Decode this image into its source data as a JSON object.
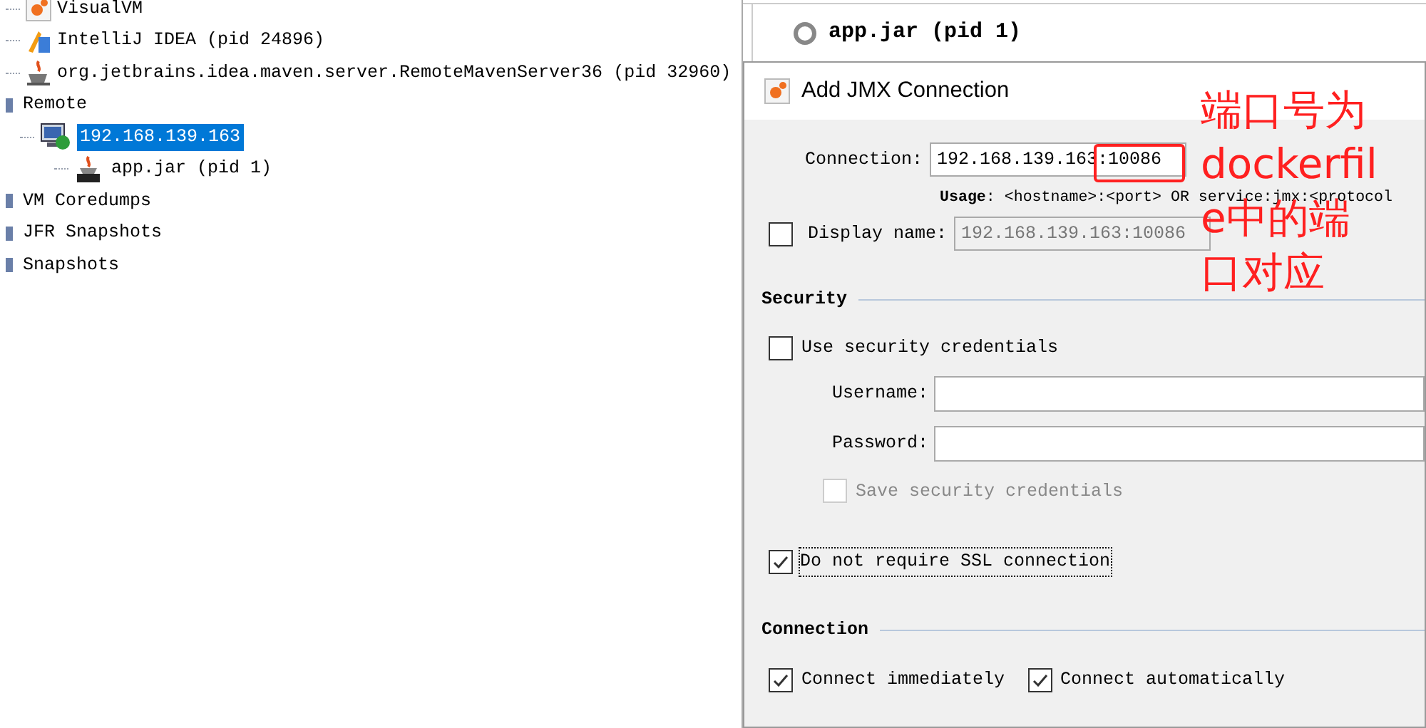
{
  "tree": {
    "continued_items": [
      {
        "label": "VisualVM",
        "kind": "visualvm"
      },
      {
        "label": "IntelliJ IDEA (pid 24896)",
        "kind": "intellij"
      },
      {
        "label": "org.jetbrains.idea.maven.server.RemoteMavenServer36 (pid 32960)",
        "kind": "java"
      }
    ],
    "roots": [
      {
        "label": "Remote",
        "kind": "folder",
        "selected": false,
        "children": [
          {
            "label": "192.168.139.163",
            "kind": "host",
            "selected": true,
            "children": [
              {
                "label": "app.jar (pid 1)",
                "kind": "jmx",
                "selected": false
              }
            ]
          }
        ]
      },
      {
        "label": "VM Coredumps",
        "kind": "folder",
        "selected": false
      },
      {
        "label": "JFR Snapshots",
        "kind": "folder",
        "selected": false
      },
      {
        "label": "Snapshots",
        "kind": "folder",
        "selected": false
      }
    ]
  },
  "process_tab": {
    "title": "app.jar (pid 1)"
  },
  "dialog": {
    "title": "Add JMX Connection",
    "connection": {
      "label": "Connection:",
      "value": "192.168.139.163:10086"
    },
    "usage": "**Usage**: <hostname>:<port> OR service:jmx:<protocol",
    "display_name": {
      "label": "Display name:",
      "checked": false,
      "value": "192.168.139.163:10086",
      "disabled": true
    },
    "security": {
      "title": "Security",
      "use_credentials": {
        "label": "Use security credentials",
        "checked": false
      },
      "username": {
        "label": "Username:"
      },
      "password": {
        "label": "Password:"
      },
      "save_credentials": {
        "label": "Save security credentials",
        "checked": false,
        "disabled": true
      }
    },
    "ssl": {
      "label": "Do not require SSL connection",
      "checked": true,
      "focused": true
    },
    "connection_section": {
      "title": "Connection",
      "options": [
        {
          "label": "Connect immediately",
          "checked": true
        },
        {
          "label": "Connect automatically",
          "checked": true
        }
      ]
    }
  },
  "annotation": {
    "lines": [
      "端口号为",
      "dockerfil",
      "e中的端",
      "口对应"
    ]
  }
}
